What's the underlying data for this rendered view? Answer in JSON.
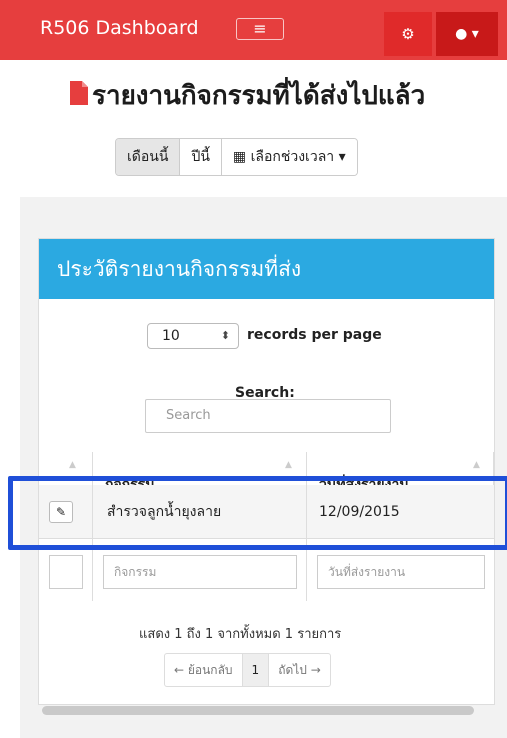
{
  "navbar": {
    "brand": "R506 Dashboard",
    "menu_toggle_icon": "hamburger-icon",
    "settings_icon": "gear-icon",
    "user_icon": "user-icon"
  },
  "page": {
    "title": "รายงานกิจกรรมที่ได้ส่งไปแล้ว",
    "title_icon": "file-icon"
  },
  "period_filter": {
    "this_month": "เดือนนี้",
    "this_year": "ปีนี้",
    "choose_range": "เลือกช่วงเวลา",
    "calendar_icon": "calendar-icon"
  },
  "panel": {
    "title": "ประวัติรายงานกิจกรรมที่ส่ง",
    "records_per_page_value": "10",
    "records_per_page_label": "records per page",
    "search_label": "Search:",
    "search_placeholder": "Search"
  },
  "table": {
    "columns": [
      "กิจกรรม",
      "วันที่ส่งรายงาน"
    ],
    "rows": [
      {
        "activity": "สำรวจลูกน้ำยุงลาย",
        "date": "12/09/2015"
      }
    ],
    "filters": {
      "activity_placeholder": "กิจกรรม",
      "date_placeholder": "วันที่ส่งรายงาน"
    }
  },
  "pagination": {
    "info": "แสดง 1 ถึง 1 จากทั้งหมด 1 รายการ",
    "prev": "← ย้อนกลับ",
    "current": "1",
    "next": "ถัดไป →"
  },
  "colors": {
    "navbar": "#e63e3e",
    "panel_header": "#2ba9e1",
    "highlight": "#1f4fd8"
  }
}
